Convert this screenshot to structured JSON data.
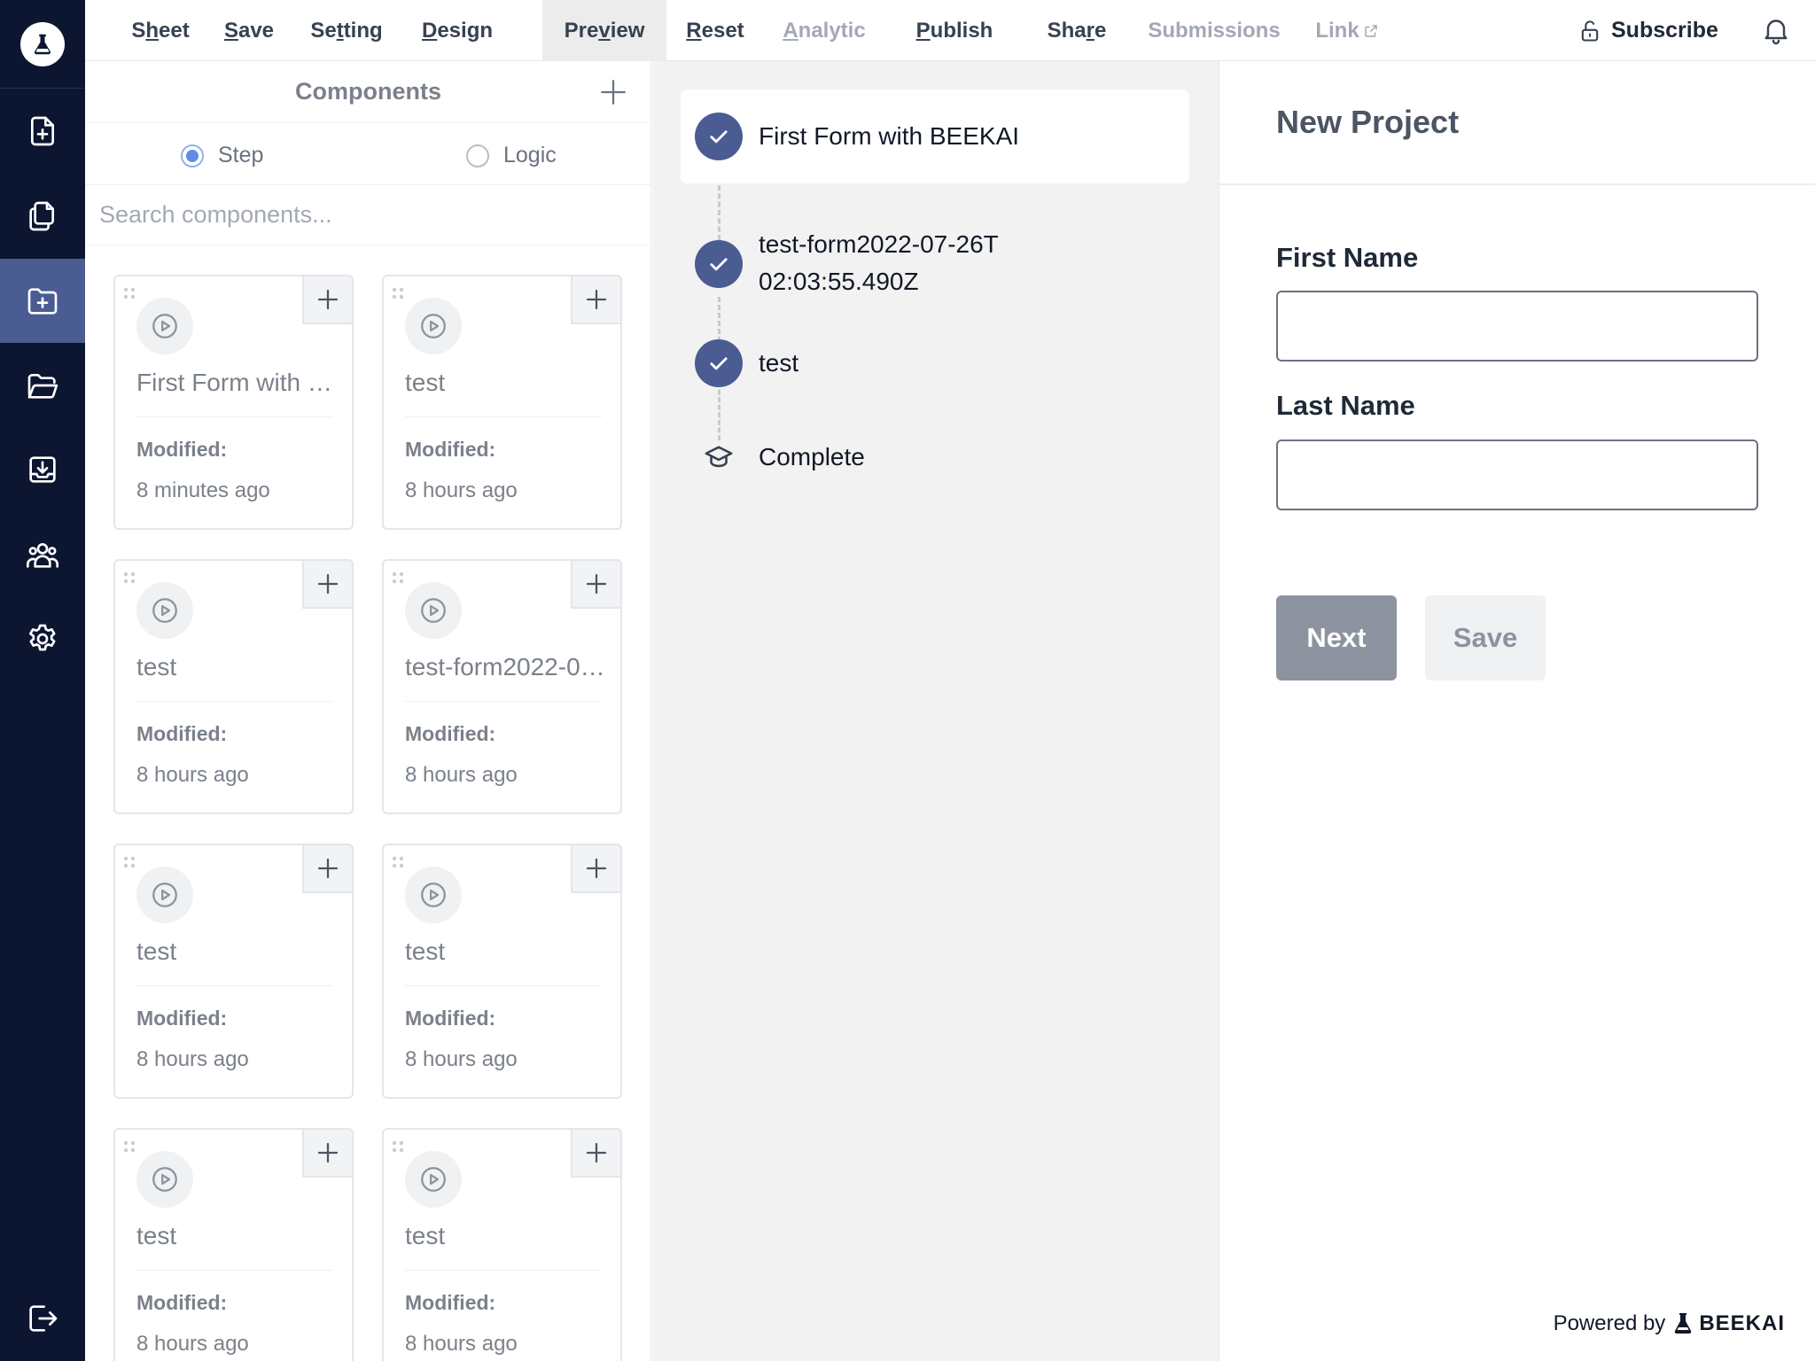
{
  "menu": {
    "items": [
      {
        "pre": "S",
        "ul": "h",
        "post": "eet"
      },
      {
        "pre": "",
        "ul": "S",
        "post": "ave"
      },
      {
        "pre": "Se",
        "ul": "t",
        "post": "ting"
      },
      {
        "pre": "",
        "ul": "D",
        "post": "esign"
      },
      {
        "pre": "Pre",
        "ul": "v",
        "post": "iew"
      },
      {
        "pre": "",
        "ul": "R",
        "post": "eset"
      },
      {
        "pre": "",
        "ul": "A",
        "post": "nalytic"
      },
      {
        "pre": "",
        "ul": "P",
        "post": "ublish"
      },
      {
        "pre": "Sha",
        "ul": "r",
        "post": "e"
      },
      {
        "pre": "Submissions",
        "ul": "",
        "post": ""
      },
      {
        "pre": "Link",
        "ul": "",
        "post": ""
      }
    ],
    "subscribe": "Subscribe"
  },
  "components": {
    "title": "Components",
    "radio_step": "Step",
    "radio_logic": "Logic",
    "search_placeholder": "Search components...",
    "cards": [
      {
        "name": "First Form with BEEKAI",
        "modified_label": "Modified:",
        "modified": "8 minutes ago"
      },
      {
        "name": "test",
        "modified_label": "Modified:",
        "modified": "8 hours ago"
      },
      {
        "name": "test",
        "modified_label": "Modified:",
        "modified": "8 hours ago"
      },
      {
        "name": "test-form2022-07-26T02:03:55.490Z",
        "modified_label": "Modified:",
        "modified": "8 hours ago"
      },
      {
        "name": "test",
        "modified_label": "Modified:",
        "modified": "8 hours ago"
      },
      {
        "name": "test",
        "modified_label": "Modified:",
        "modified": "8 hours ago"
      },
      {
        "name": "test",
        "modified_label": "Modified:",
        "modified": "8 hours ago"
      },
      {
        "name": "test",
        "modified_label": "Modified:",
        "modified": "8 hours ago"
      }
    ]
  },
  "steps": {
    "items": [
      {
        "label": "First Form with BEEKAI"
      },
      {
        "label": "test-form2022-07-26T02:03:55.490Z"
      },
      {
        "label": "test"
      },
      {
        "label": "Complete"
      }
    ]
  },
  "preview": {
    "title": "New Project",
    "first_name_label": "First Name",
    "last_name_label": "Last Name",
    "next_label": "Next",
    "save_label": "Save",
    "powered_by": "Powered by",
    "brand": "BEEKAI"
  },
  "colors": {
    "rail": "#0c1631",
    "rail_active": "#4a5c92",
    "accent": "#4a5c92"
  }
}
